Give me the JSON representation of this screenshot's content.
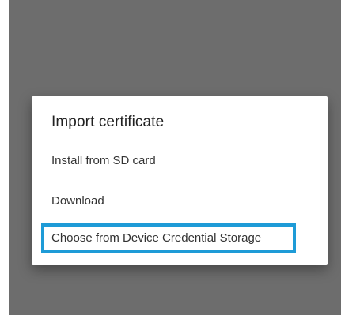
{
  "dialog": {
    "title": "Import certificate",
    "options": [
      {
        "label": "Install from SD card"
      },
      {
        "label": "Download"
      },
      {
        "label": "Choose from Device Credential Storage"
      }
    ],
    "highlight_color": "#1e9bd7"
  },
  "colors": {
    "scrim": "#6d6d6d",
    "dialog_bg": "#ffffff",
    "text": "#333333"
  }
}
